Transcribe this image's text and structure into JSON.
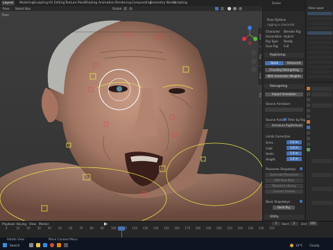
{
  "menu_tabs": [
    "Layout",
    "Modeling",
    "Sculpting",
    "UV Editing",
    "Texture Paint",
    "Shading",
    "Animation",
    "Rendering",
    "Compositing",
    "Geometry Nodes",
    "Scripting"
  ],
  "header": {
    "mode": "Pose",
    "select_box": "Select Box",
    "orientation": "Global",
    "scene": "Scene",
    "view_layer": "View Layer"
  },
  "viewport": {
    "corner_label": "Pose"
  },
  "npanel": {
    "title": "Pose Options",
    "rig_name": "rigging a character",
    "rows": [
      {
        "k": "Character",
        "v": "Blender Rig"
      },
      {
        "k": "Generation",
        "v": "Hybrid"
      },
      {
        "k": "Rig Type",
        "v": "Ready"
      },
      {
        "k": "Face Rig",
        "v": "Full"
      }
    ],
    "rig_setup": {
      "label": "Rig&Setup",
      "quick": "Quick",
      "advanced": "Advanced",
      "btn1": "Clouding Retargeting",
      "btn2": "With Automatic Weights"
    },
    "retarget": {
      "label": "Retargeting",
      "btn": "Import Animation",
      "source_label": "Source Armature",
      "source_action": "Source Action",
      "filter": "Filter by Rig",
      "armature": "Armature Rig(Default)"
    },
    "limits": {
      "label": "Limits Correction",
      "rows": [
        {
          "k": "Arms",
          "v": "1.0 m"
        },
        {
          "k": "Legs",
          "v": "1.0 m"
        },
        {
          "k": "Heels",
          "v": "1.0 m"
        },
        {
          "k": "Height",
          "v": "1.0 m"
        }
      ]
    },
    "shapekeys": {
      "label": "Phoneme Shapekeys",
      "items": [
        "Generate Phonemes",
        "Add Pose Mod",
        "Phoneme Library",
        "Convert Viseme"
      ]
    },
    "basic": {
      "label": "Basic Shapekeys",
      "btn": "Build Rig"
    },
    "utility": "Utility"
  },
  "timeline": {
    "ticks": [
      "0",
      "10",
      "20",
      "30",
      "40",
      "50",
      "60",
      "70",
      "80",
      "90",
      "100",
      "110",
      "120",
      "130",
      "140",
      "150",
      "160",
      "170",
      "180",
      "190",
      "200",
      "210",
      "220",
      "230",
      "240",
      "250"
    ],
    "current_frame": "1",
    "start": "Start",
    "start_val": "1",
    "end": "End",
    "end_val": "250",
    "playback": "Playback",
    "keying": "Keying",
    "view": "View",
    "marker": "Marker"
  },
  "status": {
    "left": "Rotate View",
    "middle": "Move Context Menu",
    "weather": "10°C",
    "weather_desc": "Cloudy"
  },
  "taskbar": {
    "search": "Search"
  },
  "colors": {
    "accent": "#4772b3",
    "bone": "#e6e14a",
    "bone_sel": "#d44f4f",
    "x_axis": "#dd3344",
    "y_axis": "#55bb33",
    "z_axis": "#3d7be0"
  }
}
